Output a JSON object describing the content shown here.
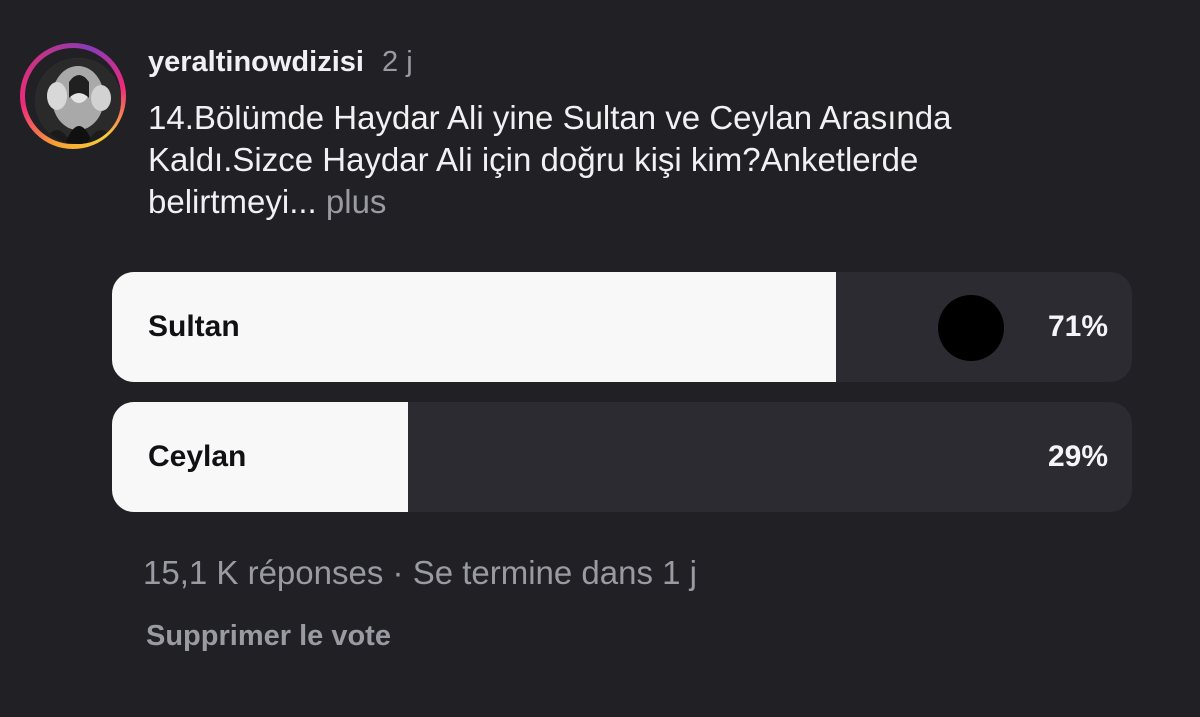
{
  "post": {
    "username": "yeraltinowdizisi",
    "time": "2 j",
    "caption_lines": [
      "14.Bölümde Haydar Ali yine Sultan ve Ceylan Arasında",
      "Kaldı.Sizce Haydar Ali için doğru kişi kim?Anketlerde",
      "belirtmeyi..."
    ],
    "more_label": "plus"
  },
  "poll": {
    "options": [
      {
        "label": "Sultan",
        "percent_text": "71%",
        "percent": 71,
        "selected": true
      },
      {
        "label": "Ceylan",
        "percent_text": "29%",
        "percent": 29,
        "selected": false
      }
    ],
    "responses": "15,1 K réponses",
    "separator": "·",
    "ends": "Se termine dans 1 j",
    "delete_vote_label": "Supprimer le vote"
  },
  "colors": {
    "background": "#202025",
    "option_track": "#2b2b31",
    "option_fill": "#f8f8f8",
    "muted_text": "#9a9aa2",
    "story_ring": [
      "#f9ce34",
      "#ee2a7b",
      "#8a3ab9"
    ]
  },
  "icons": {
    "avatar": "profile-photo-avatar",
    "voter": "voter-avatar-dot"
  }
}
